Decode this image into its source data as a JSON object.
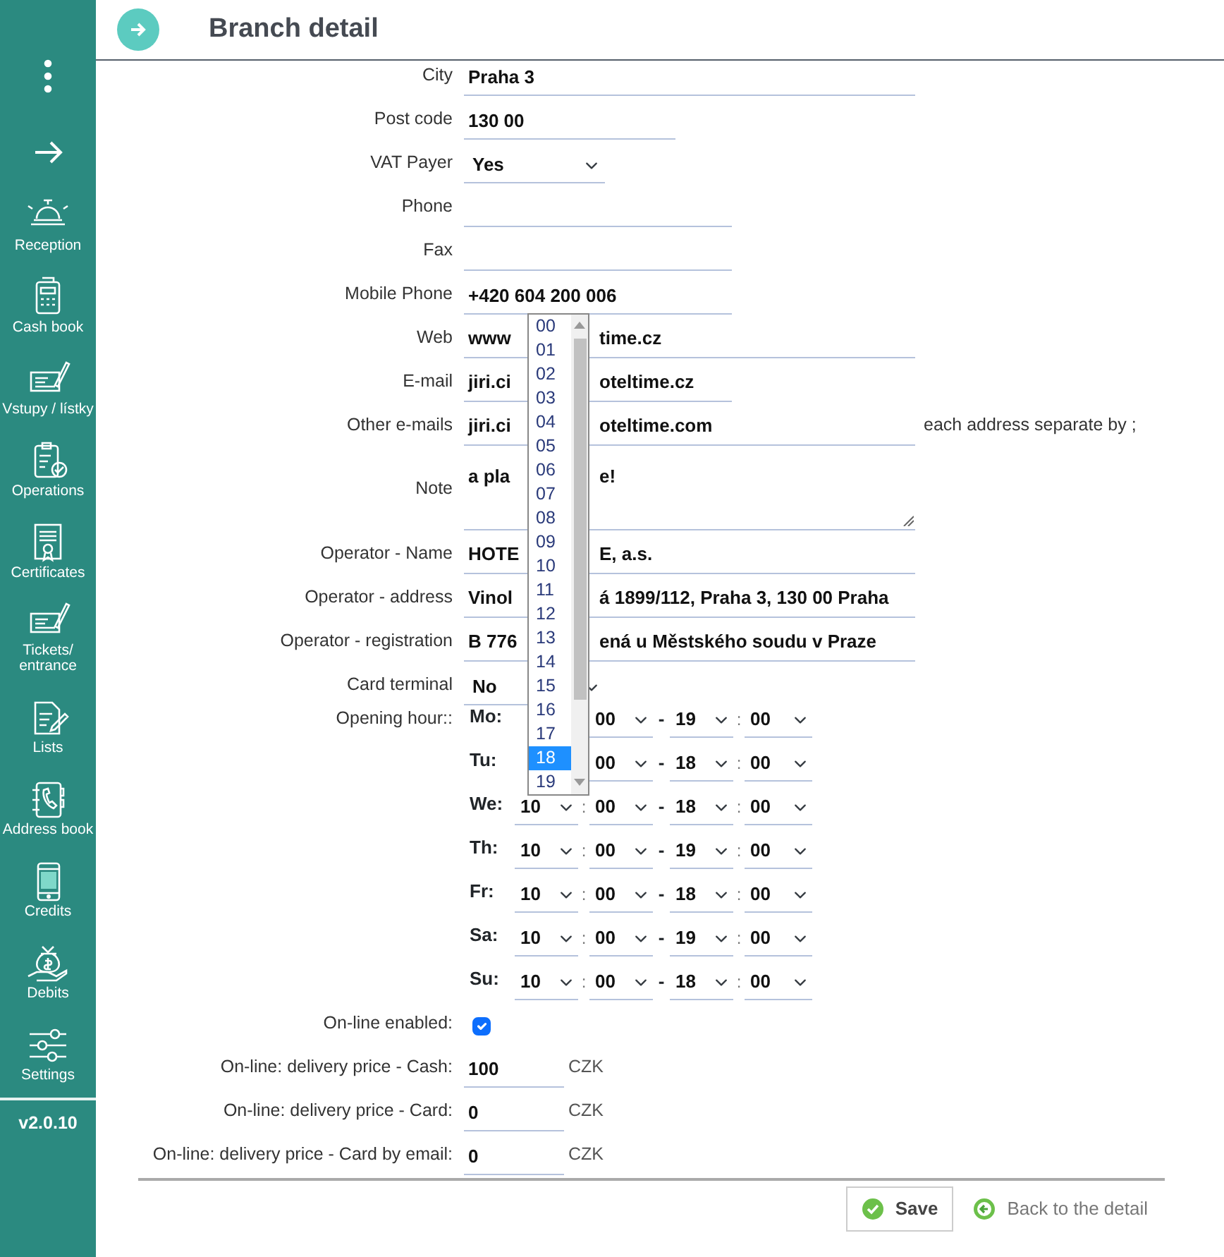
{
  "header": {
    "title": "Branch detail"
  },
  "sidebar": {
    "items": [
      {
        "label": "Reception"
      },
      {
        "label": "Cash book"
      },
      {
        "label": "Vstupy / lístky"
      },
      {
        "label": "Operations"
      },
      {
        "label": "Certificates"
      },
      {
        "label": "Tickets/ entrance"
      },
      {
        "label": "Lists"
      },
      {
        "label": "Address book"
      },
      {
        "label": "Credits"
      },
      {
        "label": "Debits"
      },
      {
        "label": "Settings"
      }
    ],
    "version": "v2.0.10"
  },
  "form": {
    "fields": [
      {
        "kind": "text",
        "label": "City",
        "value": "Praha 3"
      },
      {
        "kind": "text",
        "label": "Post code",
        "value": "130 00"
      },
      {
        "kind": "select",
        "label": "VAT Payer",
        "value": "Yes"
      },
      {
        "kind": "text",
        "label": "Phone"
      },
      {
        "kind": "text",
        "label": "Fax"
      },
      {
        "kind": "text",
        "label": "Mobile Phone",
        "value": "+420 604 200 006"
      },
      {
        "kind": "covered",
        "label": "Web",
        "visible_parts": [
          "www",
          "time.cz"
        ]
      },
      {
        "kind": "covered",
        "label": "E-mail",
        "visible_parts": [
          "jiri.ci",
          "oteltime.cz"
        ]
      },
      {
        "kind": "covered",
        "label": "Other e-mails",
        "visible_parts": [
          "jiri.ci",
          "oteltime.com"
        ],
        "hint": "each address separate by ;"
      },
      {
        "kind": "note",
        "label": "Note",
        "visible_parts": [
          "a pla",
          "e!"
        ]
      },
      {
        "kind": "covered",
        "label": "Operator - Name",
        "visible_parts": [
          "HOTE",
          "E, a.s."
        ]
      },
      {
        "kind": "covered",
        "label": "Operator - address",
        "visible_parts": [
          "Vinol",
          "á 1899/112, Praha 3, 130 00 Praha"
        ]
      },
      {
        "kind": "covered",
        "label": "Operator - registration",
        "visible_parts": [
          "B 776",
          "ená u Městského soudu v Praze"
        ]
      },
      {
        "kind": "select",
        "label": "Card terminal",
        "value": "No"
      },
      {
        "kind": "hours",
        "label": "Opening hour::",
        "days": [
          {
            "day": "Mo:",
            "open_minute": "00",
            "dash": "-",
            "close_hour": "19",
            "colon": ":",
            "close_minute": "00"
          },
          {
            "day": "Tu:",
            "open_minute": "00",
            "dash": "-",
            "close_hour": "18",
            "colon": ":",
            "close_minute": "00"
          },
          {
            "day": "We:",
            "open_hour": "10",
            "colon_open": ":",
            "open_minute": "00",
            "dash": "-",
            "close_hour": "18",
            "colon": ":",
            "close_minute": "00"
          },
          {
            "day": "Th:",
            "open_hour": "10",
            "colon_open": ":",
            "open_minute": "00",
            "dash": "-",
            "close_hour": "19",
            "colon": ":",
            "close_minute": "00"
          },
          {
            "day": "Fr:",
            "open_hour": "10",
            "colon_open": ":",
            "open_minute": "00",
            "dash": "-",
            "close_hour": "18",
            "colon": ":",
            "close_minute": "00"
          },
          {
            "day": "Sa:",
            "open_hour": "10",
            "colon_open": ":",
            "open_minute": "00",
            "dash": "-",
            "close_hour": "19",
            "colon": ":",
            "close_minute": "00"
          },
          {
            "day": "Su:",
            "open_hour": "10",
            "colon_open": ":",
            "open_minute": "00",
            "dash": "-",
            "close_hour": "18",
            "colon": ":",
            "close_minute": "00"
          }
        ]
      },
      {
        "kind": "checkbox",
        "label": "On-line enabled:",
        "checked": true
      },
      {
        "kind": "price",
        "label": "On-line: delivery price - Cash:",
        "value": "100",
        "unit": "CZK"
      },
      {
        "kind": "price",
        "label": "On-line: delivery price - Card:",
        "value": "0",
        "unit": "CZK"
      },
      {
        "kind": "price",
        "label": "On-line: delivery price - Card by email:",
        "value": "0",
        "unit": "CZK"
      }
    ],
    "open_dropdown": {
      "options": [
        {
          "label": "00",
          "selected": false
        },
        {
          "label": "01",
          "selected": false
        },
        {
          "label": "02",
          "selected": false
        },
        {
          "label": "03",
          "selected": false
        },
        {
          "label": "04",
          "selected": false
        },
        {
          "label": "05",
          "selected": false
        },
        {
          "label": "06",
          "selected": false
        },
        {
          "label": "07",
          "selected": false
        },
        {
          "label": "08",
          "selected": false
        },
        {
          "label": "09",
          "selected": false
        },
        {
          "label": "10",
          "selected": false
        },
        {
          "label": "11",
          "selected": false
        },
        {
          "label": "12",
          "selected": false
        },
        {
          "label": "13",
          "selected": false
        },
        {
          "label": "14",
          "selected": false
        },
        {
          "label": "15",
          "selected": false
        },
        {
          "label": "16",
          "selected": false
        },
        {
          "label": "17",
          "selected": false
        },
        {
          "label": "18",
          "selected": true
        },
        {
          "label": "19",
          "selected": false
        }
      ]
    },
    "actions": {
      "save": "Save",
      "back": "Back to the detail"
    }
  }
}
